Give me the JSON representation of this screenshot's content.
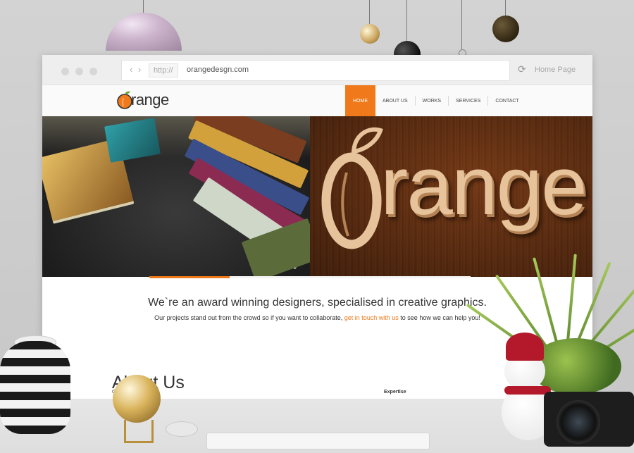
{
  "browser": {
    "protocol": "http://",
    "url": "orangedesgn.com",
    "home_label": "Home Page",
    "back_icon": "chevron-left-icon",
    "forward_icon": "chevron-right-icon",
    "reload_icon": "reload-icon"
  },
  "site": {
    "logo_text": "range",
    "nav": [
      {
        "label": "HOME",
        "active": true
      },
      {
        "label": "ABOUT US",
        "active": false
      },
      {
        "label": "WORKS",
        "active": false
      },
      {
        "label": "SERVICES",
        "active": false
      },
      {
        "label": "CONTACT",
        "active": false
      }
    ],
    "hero_sign_text": "range",
    "tagline": "We`re an award winning designers, specialised in creative graphics.",
    "subline_before": "Our projects stand out from the crowd so if you want to collaborate, ",
    "subline_link": "get in touch with us",
    "subline_after": " to see how we can help you!",
    "about_title": "About Us",
    "expertise_label": "Expertise",
    "about_col_letter": "C"
  },
  "colors": {
    "accent": "#f07a1b",
    "text": "#333333"
  }
}
